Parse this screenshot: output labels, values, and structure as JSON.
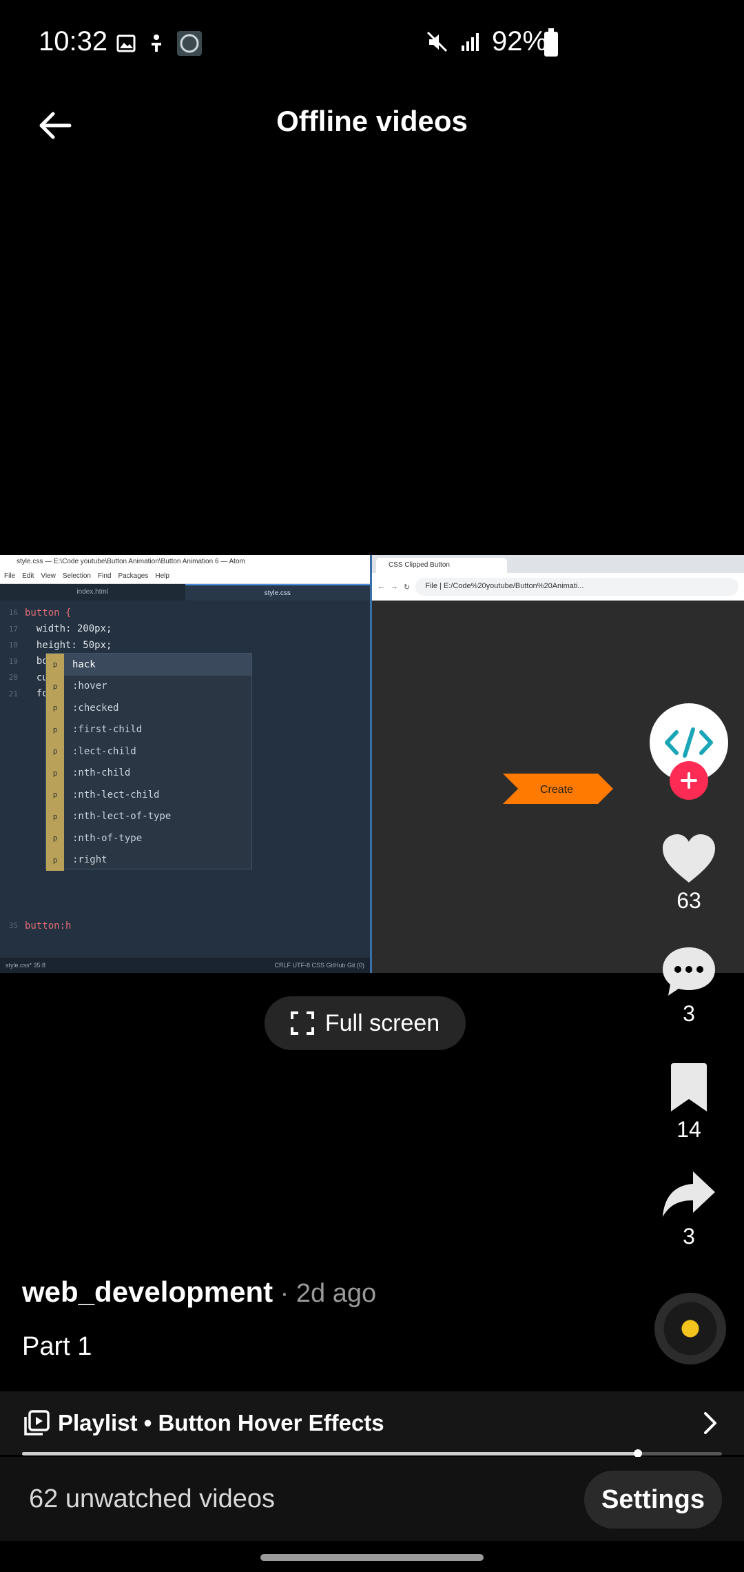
{
  "status": {
    "time": "10:32",
    "battery": "92%"
  },
  "header": {
    "title": "Offline videos"
  },
  "video": {
    "editor": {
      "title": "style.css — E:\\Code youtube\\Button Animation\\Button Animation 6 — Atom",
      "menu": [
        "File",
        "Edit",
        "View",
        "Selection",
        "Find",
        "Packages",
        "Help"
      ],
      "tabs": [
        "index.html",
        "style.css"
      ],
      "code_lines": [
        {
          "n": "16",
          "text": "button {"
        },
        {
          "n": "17",
          "text": "  width: 200px;"
        },
        {
          "n": "18",
          "text": "  height: 50px;"
        },
        {
          "n": "19",
          "text": "  border: none;"
        },
        {
          "n": "20",
          "text": "  cursor: pointer;"
        },
        {
          "n": "21",
          "text": "  font-size: 20px;"
        }
      ],
      "autocomplete": [
        "hack",
        ":hover",
        ":checked",
        ":first-child",
        ":lect-child",
        ":nth-child",
        ":nth-lect-child",
        ":nth-lect-of-type",
        ":nth-of-type",
        ":right"
      ],
      "current_line": {
        "n": "35",
        "text": "button:h"
      },
      "statusbar_left": "style.css*  35:8",
      "statusbar_right": "CRLF  UTF-8  CSS  GitHub  Git (0)"
    },
    "browser": {
      "tab_title": "CSS Clipped Button",
      "url": "File | E:/Code%20youtube/Button%20Animati...",
      "button_label": "Create"
    },
    "fullscreen_label": "Full screen"
  },
  "rail": {
    "likes": "63",
    "comments": "3",
    "saves": "14",
    "shares": "3"
  },
  "caption": {
    "author": "web_development",
    "meta": " · 2d ago",
    "text": "Part 1"
  },
  "playlist": {
    "label": "Playlist • Button Hover Effects",
    "progress": 0.88
  },
  "footer": {
    "unwatched": "62 unwatched videos",
    "settings_label": "Settings"
  },
  "colors": {
    "accent": "#fe2c55",
    "clip_button": "#ff7a00",
    "avatar_code": "#1aa6b7"
  }
}
